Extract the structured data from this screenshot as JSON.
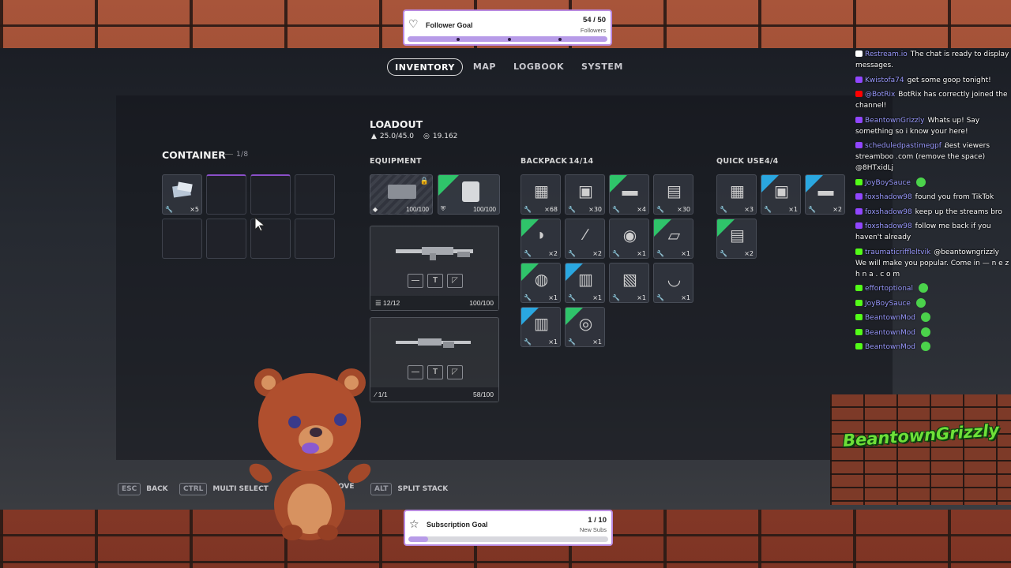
{
  "nav": {
    "tabs": [
      {
        "label": "INVENTORY",
        "active": true
      },
      {
        "label": "MAP"
      },
      {
        "label": "LOGBOOK"
      },
      {
        "label": "SYSTEM"
      }
    ]
  },
  "loadout": {
    "title": "LOADOUT",
    "weight": "25.0/45.0",
    "value": "19.162"
  },
  "container": {
    "title": "CONTAINER",
    "count": "1/8",
    "slots": [
      {
        "icon": "scrap-icon",
        "count": "×5",
        "filled": true
      },
      {
        "filled": false,
        "highlight": true
      },
      {
        "filled": false,
        "highlight": true
      },
      {
        "filled": false
      },
      {
        "filled": false
      },
      {
        "filled": false
      },
      {
        "filled": false
      },
      {
        "filled": false
      }
    ]
  },
  "equipment": {
    "title": "EQUIPMENT",
    "augment": {
      "durability": "100/100"
    },
    "shield": {
      "durability": "100/100"
    },
    "weapon1": {
      "ammo": "12/12",
      "durability": "100/100"
    },
    "weapon2": {
      "ammo": "1/1",
      "durability": "58/100"
    }
  },
  "backpack": {
    "title": "BACKPACK",
    "count": "14/14",
    "items": [
      {
        "count": "×68",
        "rarity": "none"
      },
      {
        "count": "×30",
        "rarity": "none"
      },
      {
        "count": "×4",
        "rarity": "green"
      },
      {
        "count": "×30",
        "rarity": "none"
      },
      {
        "count": "×2",
        "rarity": "green"
      },
      {
        "count": "×2",
        "rarity": "none"
      },
      {
        "count": "×1",
        "rarity": "none"
      },
      {
        "count": "×1",
        "rarity": "green"
      },
      {
        "count": "×1",
        "rarity": "green"
      },
      {
        "count": "×1",
        "rarity": "blue"
      },
      {
        "count": "×1",
        "rarity": "none"
      },
      {
        "count": "×1",
        "rarity": "none"
      },
      {
        "count": "×1",
        "rarity": "blue"
      },
      {
        "count": "×1",
        "rarity": "green"
      }
    ]
  },
  "quick_use": {
    "title": "QUICK USE",
    "count": "4/4",
    "items": [
      {
        "count": "×3",
        "rarity": "none"
      },
      {
        "count": "×1",
        "rarity": "blue"
      },
      {
        "count": "×2",
        "rarity": "blue"
      },
      {
        "count": "×2",
        "rarity": "green"
      }
    ]
  },
  "hints": [
    {
      "key": "ESC",
      "label": "BACK"
    },
    {
      "key": "CTRL",
      "label": "MULTI SELECT"
    },
    {
      "key": "",
      "label": "OVE"
    },
    {
      "key": "ALT",
      "label": "SPLIT STACK"
    }
  ],
  "follower_goal": {
    "title": "Follower Goal",
    "value": "54 / 50",
    "current": "54",
    "target": "50",
    "unit": "Followers",
    "progress": 1.0
  },
  "subscription_goal": {
    "title": "Subscription Goal",
    "value": "1 / 10",
    "current": "1",
    "target": "10",
    "unit": "New Subs",
    "progress": 0.1
  },
  "chat": [
    {
      "platform": "restream",
      "user": "Restream.io",
      "text": "The chat is ready to display messages."
    },
    {
      "platform": "twitch",
      "user": "Kwistofa74",
      "text": "get some goop tonight!"
    },
    {
      "platform": "youtube",
      "user": "@BotRix",
      "text": "BotRix has correctly joined the channel!"
    },
    {
      "platform": "twitch",
      "user": "BeantownGrizzly",
      "text": "Whats up! Say something so i know your here!"
    },
    {
      "platform": "twitch",
      "user": "scheduledpastimegpf",
      "text": "Ᏸest viewers streamboo .com (remove the space) @8HTxidLj"
    },
    {
      "platform": "kick",
      "user": "JoyBoySauce",
      "text": "",
      "emote": true
    },
    {
      "platform": "twitch",
      "user": "foxshadow98",
      "text": "found you from TikTok"
    },
    {
      "platform": "twitch",
      "user": "foxshadow98",
      "text": "keep up the streams bro"
    },
    {
      "platform": "twitch",
      "user": "foxshadow98",
      "text": "follow me back if you haven't already"
    },
    {
      "platform": "kick",
      "user": "traumaticriffleltvik",
      "text": "@beantowngrizzly We will make you popular. Come in — n e z h n a . c o m"
    },
    {
      "platform": "kick",
      "user": "effortoptional",
      "text": "",
      "emote": true
    },
    {
      "platform": "kick",
      "user": "JoyBoySauce",
      "text": "",
      "emote": true
    },
    {
      "platform": "kick",
      "user": "BeantownMod",
      "text": "",
      "emote": true
    },
    {
      "platform": "kick",
      "user": "BeantownMod",
      "text": "",
      "emote": true
    },
    {
      "platform": "kick",
      "user": "BeantownMod",
      "text": "",
      "emote": true
    }
  ],
  "branding": {
    "logo_text": "BeantownGrizzly",
    "logo_color": "#6ee038"
  },
  "colors": {
    "rarity_green": "#2fc46a",
    "rarity_blue": "#2aa7e0",
    "highlight_purple": "#8a4fc8",
    "goal_bar": "#b79be8"
  }
}
